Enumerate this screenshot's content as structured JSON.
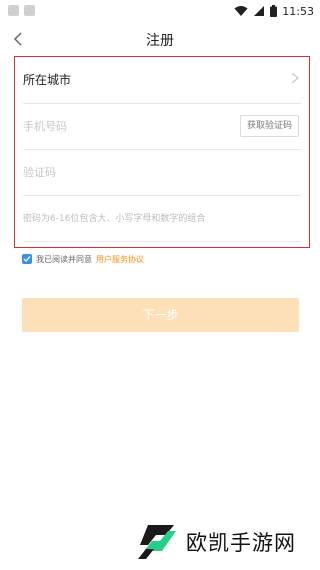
{
  "status_bar": {
    "time": "11:53"
  },
  "header": {
    "title": "注册",
    "back_icon": "chevron-left-icon"
  },
  "form": {
    "city_label": "所在城市",
    "phone_placeholder": "手机号码",
    "get_code_label": "获取验证码",
    "code_placeholder": "验证码",
    "password_hint": "密码为6-16位包含大、小写字母和数字的组合"
  },
  "agreement": {
    "checked": true,
    "text": "我已阅读并同意",
    "link": "用户服务协议"
  },
  "next_button": {
    "label": "下一步"
  },
  "watermark": {
    "text": "欧凯手游网"
  },
  "colors": {
    "accent": "#ff8c1a",
    "button_disabled": "#fde0b8",
    "highlight_border": "#d9302a",
    "checkbox": "#3a8fe8"
  }
}
